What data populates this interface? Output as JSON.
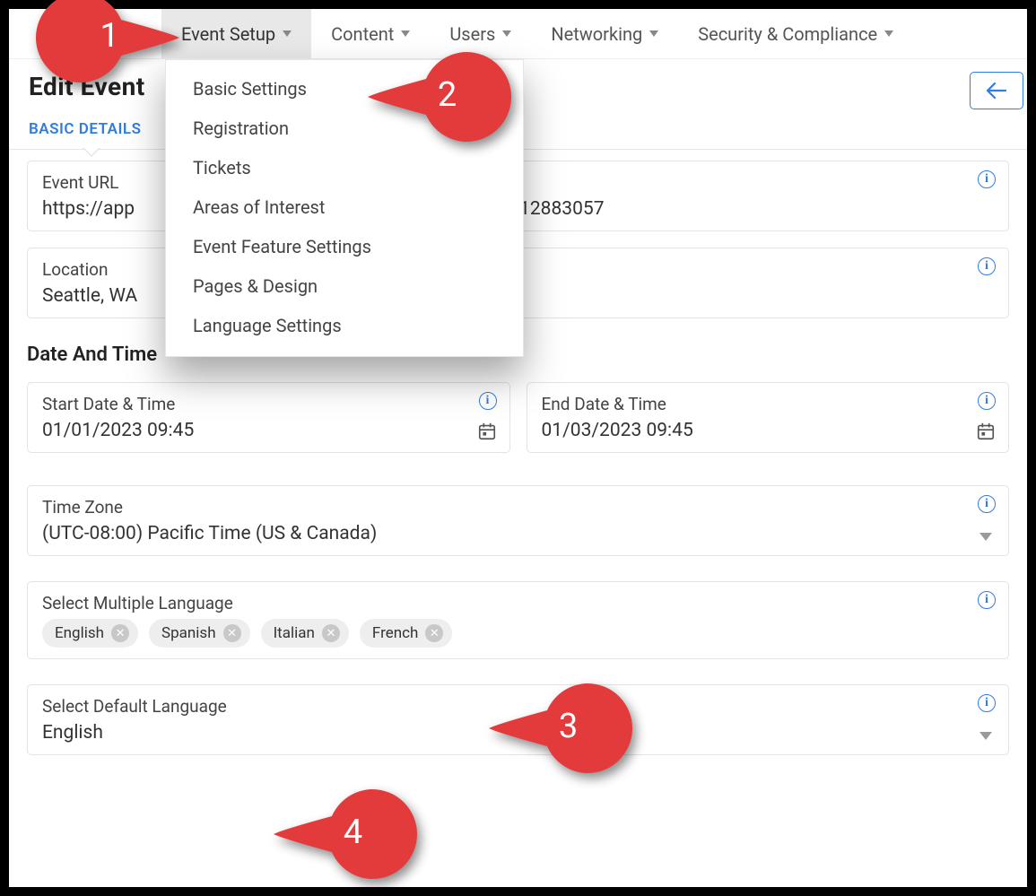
{
  "nav": {
    "items": [
      {
        "label": "Event Setup"
      },
      {
        "label": "Content"
      },
      {
        "label": "Users"
      },
      {
        "label": "Networking"
      },
      {
        "label": "Security & Compliance"
      }
    ]
  },
  "page_heading": "Edit Event",
  "breadcrumb_tab": "BASIC DETAILS",
  "dropdown": {
    "items": [
      "Basic Settings",
      "Registration",
      "Tickets",
      "Areas of Interest",
      "Event Feature Settings",
      "Pages & Design",
      "Language Settings"
    ]
  },
  "form": {
    "event_url": {
      "label": "Event URL",
      "value_left": "https://app",
      "value_right": "2202112883057"
    },
    "location": {
      "label": "Location",
      "value": "Seattle, WA"
    },
    "date_time_title": "Date And Time",
    "start": {
      "label": "Start Date & Time",
      "value": "01/01/2023 09:45"
    },
    "end": {
      "label": "End Date & Time",
      "value": "01/03/2023 09:45"
    },
    "tz": {
      "label": "Time Zone",
      "value": "(UTC-08:00) Pacific Time (US & Canada)"
    },
    "multi_lang": {
      "label": "Select Multiple Language",
      "chips": [
        "English",
        "Spanish",
        "Italian",
        "French"
      ]
    },
    "default_lang": {
      "label": "Select Default Language",
      "value": "English"
    }
  },
  "annotations": [
    "1",
    "2",
    "3",
    "4"
  ]
}
